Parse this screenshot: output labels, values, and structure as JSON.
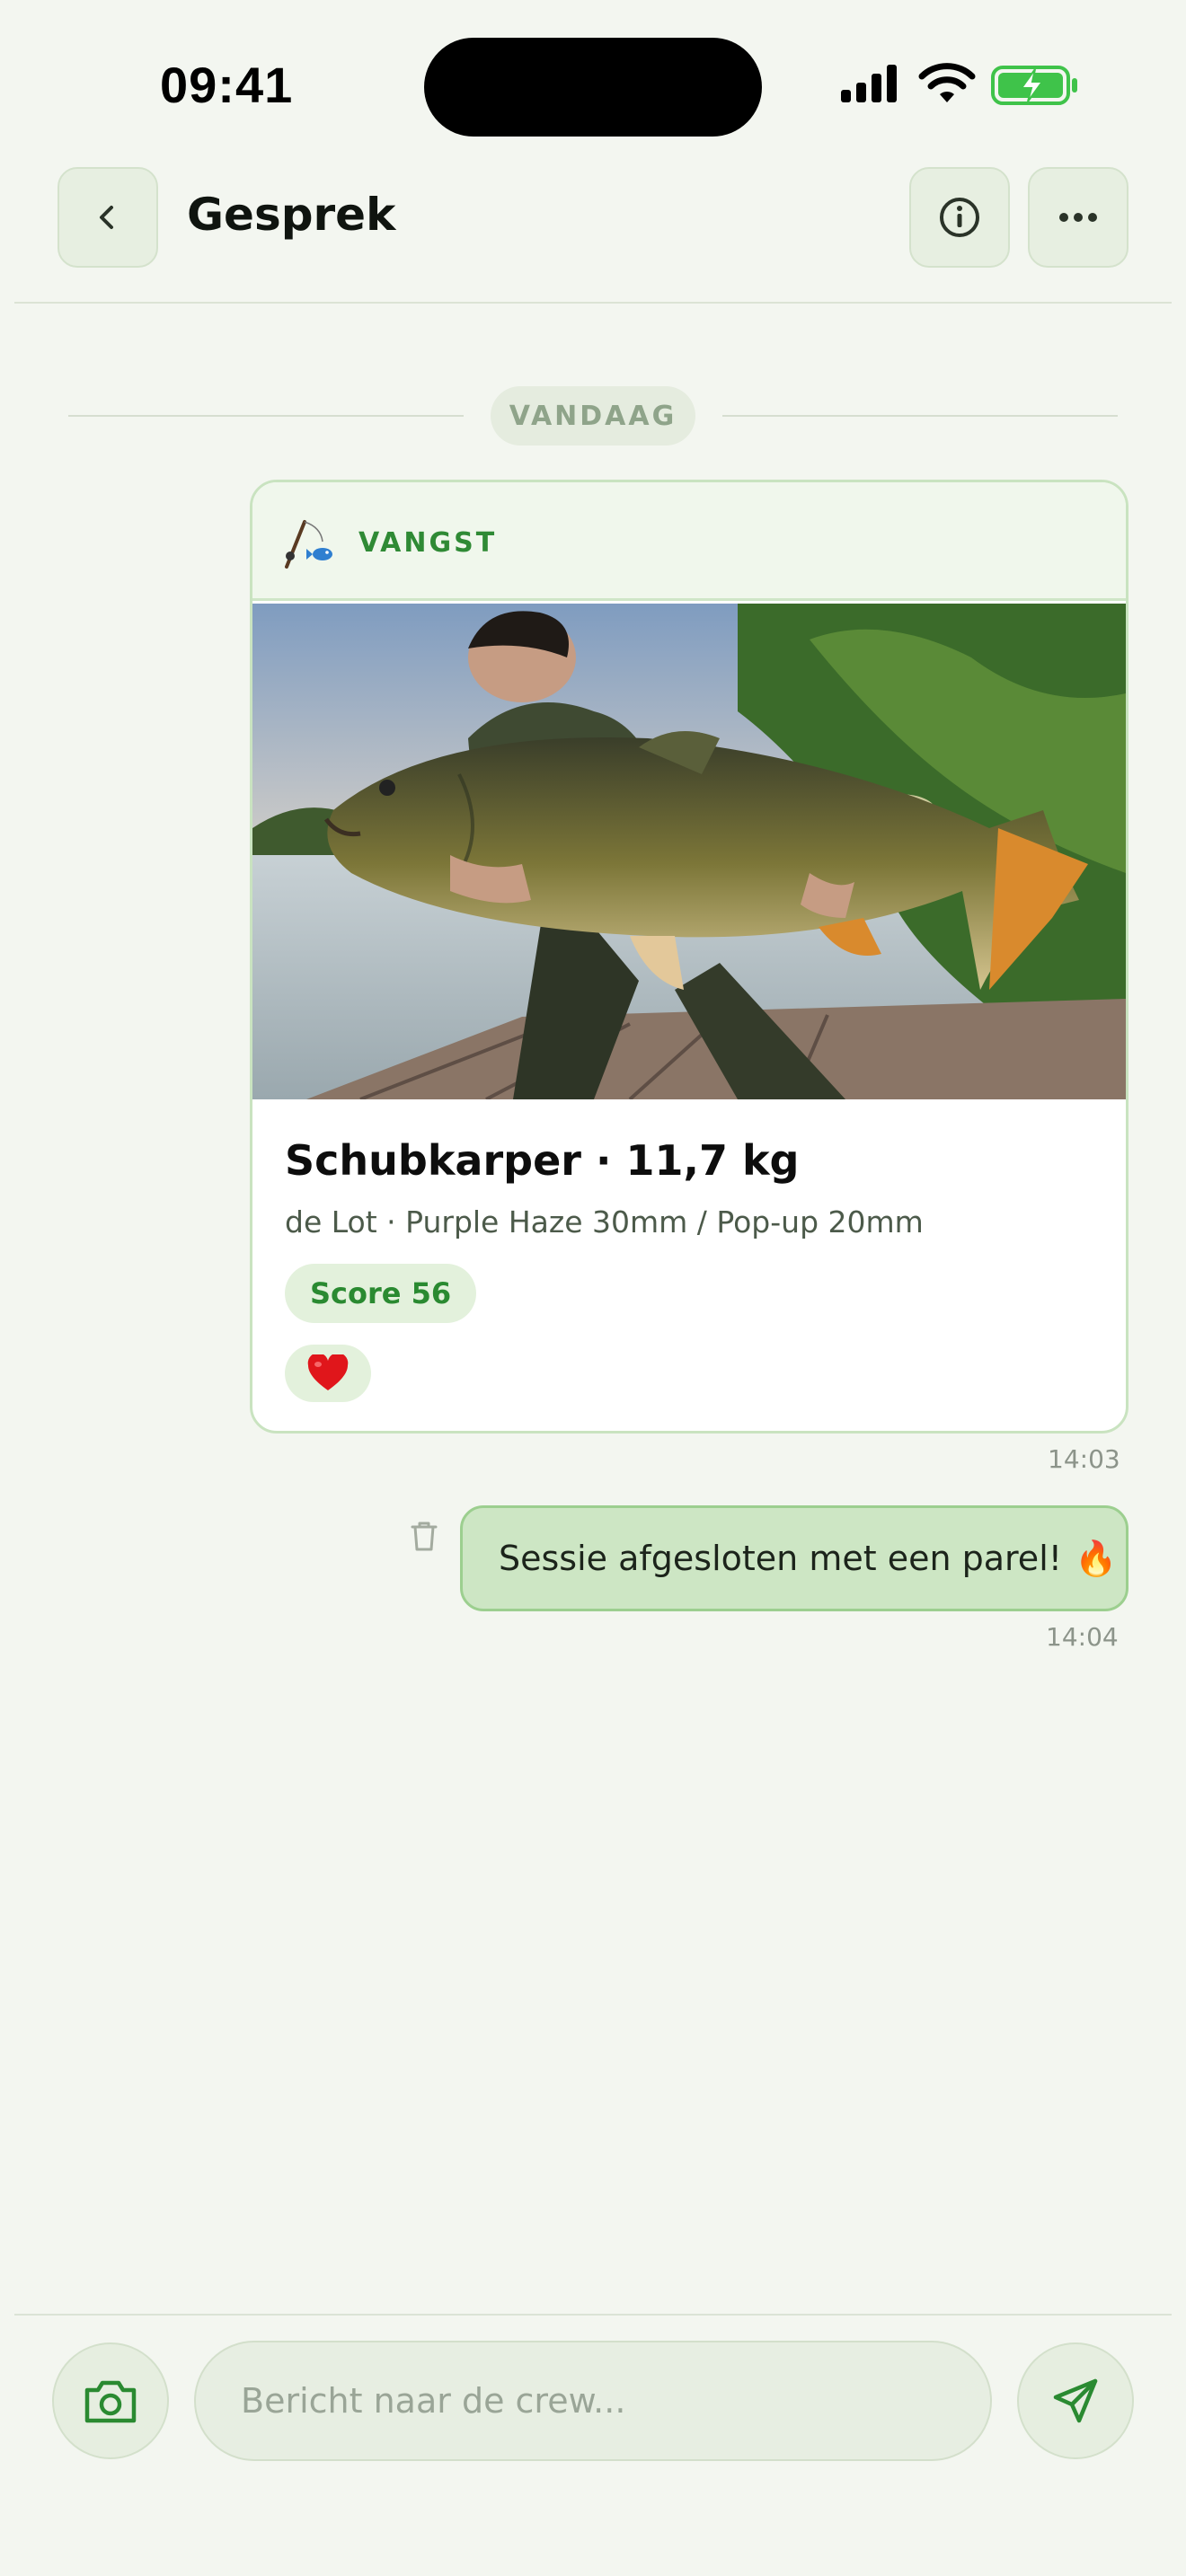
{
  "status_bar": {
    "time": "09:41"
  },
  "header": {
    "title": "Gesprek",
    "back_icon": "chevron-left-icon",
    "info_icon": "info-icon",
    "more_icon": "more-horizontal-icon"
  },
  "separator": {
    "label": "VANDAAG"
  },
  "catch_message": {
    "kind_label": "VANGST",
    "kind_icon": "fishing-rod-icon",
    "title": "Schubkarper · 11,7 kg",
    "details": "de Lot · Purple Haze 30mm / Pop-up 20mm",
    "score": "Score 56",
    "reaction": "❤️",
    "time": "14:03"
  },
  "text_message": {
    "text": "Sessie afgesloten met een parel!",
    "emoji": "🔥",
    "time": "14:04",
    "delete_icon": "trash-icon"
  },
  "composer": {
    "placeholder": "Bericht naar de crew...",
    "value": "",
    "camera_icon": "camera-icon",
    "send_icon": "send-icon"
  },
  "colors": {
    "background": "#f3f6f0",
    "accent": "#2f8a35",
    "bubble": "#cde6c4",
    "battery": "#3fc34a"
  }
}
